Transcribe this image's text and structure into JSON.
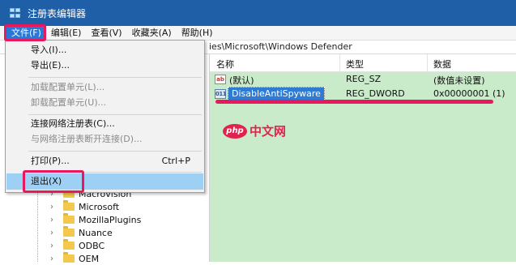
{
  "window": {
    "title": "注册表编辑器",
    "icon": "registry-editor-icon"
  },
  "menubar": {
    "items": [
      {
        "label": "文件(F)",
        "active": true
      },
      {
        "label": "编辑(E)"
      },
      {
        "label": "查看(V)"
      },
      {
        "label": "收藏夹(A)"
      },
      {
        "label": "帮助(H)"
      }
    ]
  },
  "address": {
    "path_visible": "ies\\Microsoft\\Windows Defender"
  },
  "file_menu": {
    "items": [
      {
        "label": "导入(I)...",
        "enabled": true
      },
      {
        "label": "导出(E)...",
        "enabled": true
      },
      {
        "label": "加载配置单元(L)...",
        "enabled": false
      },
      {
        "label": "卸载配置单元(U)...",
        "enabled": false
      },
      {
        "label": "连接网络注册表(C)...",
        "enabled": true
      },
      {
        "label": "与网络注册表断开连接(D)...",
        "enabled": false
      },
      {
        "label": "打印(P)...",
        "shortcut": "Ctrl+P",
        "enabled": true
      },
      {
        "label": "退出(X)",
        "enabled": true,
        "highlighted": true
      }
    ]
  },
  "tree": {
    "items": [
      {
        "label": "Macrovision"
      },
      {
        "label": "Microsoft"
      },
      {
        "label": "MozillaPlugins"
      },
      {
        "label": "Nuance"
      },
      {
        "label": "ODBC"
      },
      {
        "label": "OEM"
      }
    ]
  },
  "values_list": {
    "columns": {
      "name": "名称",
      "type": "类型",
      "data": "数据"
    },
    "rows": [
      {
        "icon": "string-value-icon",
        "icon_text": "ab",
        "name": "(默认)",
        "type": "REG_SZ",
        "data": "(数值未设置)"
      },
      {
        "icon": "dword-value-icon",
        "icon_text": "011",
        "name": "DisableAntiSpyware",
        "type": "REG_DWORD",
        "data": "0x00000001 (1)",
        "selected": true
      }
    ]
  },
  "watermark": {
    "logo": "php",
    "text": "中文网"
  },
  "colors": {
    "titlebar": "#1f5fa8",
    "list_background": "#c9ebca",
    "highlight_frame": "#e8185e",
    "menu_highlight": "#9ed0f5",
    "selection": "#2f7bd3"
  }
}
